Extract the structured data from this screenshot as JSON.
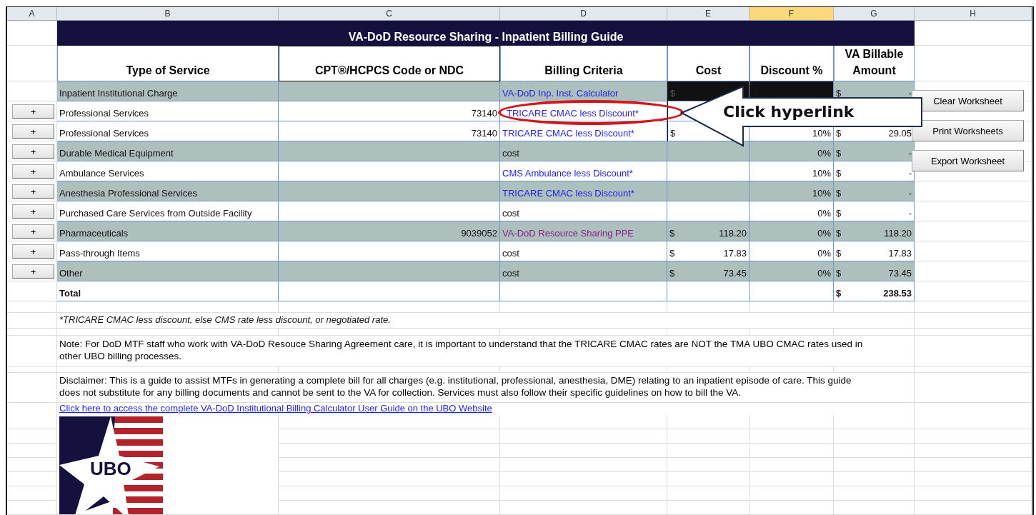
{
  "column_headers": [
    {
      "label": "A",
      "selected": false
    },
    {
      "label": "B",
      "selected": false
    },
    {
      "label": "C",
      "selected": false
    },
    {
      "label": "D",
      "selected": false
    },
    {
      "label": "E",
      "selected": false
    },
    {
      "label": "F",
      "selected": true
    },
    {
      "label": "G",
      "selected": false
    },
    {
      "label": "H",
      "selected": false
    }
  ],
  "title": "VA-DoD Resource Sharing - Inpatient Billing Guide",
  "table_headers": [
    "Type of Service",
    "CPT®/HCPCS Code or NDC",
    "Billing Criteria",
    "Cost",
    "Discount %",
    "VA Billable Amount"
  ],
  "rows": [
    {
      "service": "Inpatient Institutional Charge",
      "criteria": "VA-DoD Inp. Inst. Calculator",
      "hyperlink": true,
      "visited": false,
      "circled": false,
      "cost_sign": "$",
      "masked": true,
      "billable_sign": "$",
      "billable": "-",
      "shaded": true
    },
    {
      "button": "+",
      "service": "Professional Services",
      "code": "73140",
      "criteria": "TRICARE CMAC less Discount*",
      "hyperlink": true,
      "visited": false,
      "circled": true,
      "shaded": false,
      "masked": false
    },
    {
      "button": "+",
      "service": "Professional Services",
      "code": "73140",
      "criteria": "TRICARE CMAC less Discount*",
      "hyperlink": true,
      "visited": false,
      "circled": false,
      "cost_sign": "$",
      "discount": "10%",
      "billable_sign": "$",
      "billable": "29.05",
      "shaded": false,
      "masked": false
    },
    {
      "button": "+",
      "service": "Durable Medical Equipment",
      "criteria": "cost",
      "hyperlink": false,
      "visited": false,
      "circled": false,
      "discount": "0%",
      "billable_sign": "$",
      "billable": "-",
      "shaded": true,
      "masked": false
    },
    {
      "button": "+",
      "service": "Ambulance Services",
      "criteria": "CMS Ambulance less Discount*",
      "hyperlink": true,
      "visited": false,
      "circled": false,
      "discount": "10%",
      "billable_sign": "$",
      "billable": "-",
      "shaded": false,
      "masked": false
    },
    {
      "button": "+",
      "service": "Anesthesia Professional Services",
      "criteria": "TRICARE CMAC less Discount*",
      "hyperlink": true,
      "visited": false,
      "circled": false,
      "discount": "10%",
      "billable_sign": "$",
      "billable": "-",
      "shaded": true,
      "masked": false
    },
    {
      "button": "+",
      "service": "Purchased Care Services from Outside Facility",
      "criteria": "cost",
      "hyperlink": false,
      "visited": false,
      "circled": false,
      "discount": "0%",
      "billable_sign": "$",
      "billable": "-",
      "shaded": false,
      "masked": false
    },
    {
      "button": "+",
      "service": "Pharmaceuticals",
      "code": "9039052",
      "criteria": "VA-DoD Resource Sharing PPE",
      "hyperlink": true,
      "visited": true,
      "circled": false,
      "cost_sign": "$",
      "cost": "118.20",
      "discount": "0%",
      "billable_sign": "$",
      "billable": "118.20",
      "shaded": true,
      "masked": false
    },
    {
      "button": "+",
      "service": "Pass-through Items",
      "criteria": "cost",
      "hyperlink": false,
      "visited": false,
      "circled": false,
      "cost_sign": "$",
      "cost": "17.83",
      "discount": "0%",
      "billable_sign": "$",
      "billable": "17.83",
      "shaded": false,
      "masked": false
    },
    {
      "button": "+",
      "service": "Other",
      "criteria": "cost",
      "hyperlink": false,
      "visited": false,
      "circled": false,
      "cost_sign": "$",
      "cost": "73.45",
      "discount": "0%",
      "billable_sign": "$",
      "billable": "73.45",
      "shaded": true,
      "masked": false
    }
  ],
  "total": {
    "label": "Total",
    "sign": "$",
    "amount": "238.53"
  },
  "side_buttons": [
    "Clear Worksheet",
    "Print Worksheets",
    "Export Worksheet"
  ],
  "footnote": "*TRICARE CMAC less discount, else CMS rate less discount, or negotiated rate.",
  "note": "Note: For DoD MTF staff who work with VA-DoD Resouce Sharing Agreement care, it is important to understand that the TRICARE CMAC rates are NOT the TMA UBO CMAC rates used in other UBO billing processes.",
  "disclaimer": "Disclaimer: This is a guide to assist MTFs in generating a complete bill for all charges (e.g. institutional, professional, anesthesia, DME) relating to an inpatient episode of care. This guide does not substitute for any billing documents and cannot be sent to the VA for collection. Services must also follow their specific guidelines on how to bill the VA.",
  "guide_link": "Click here to access the complete VA-DoD Institutional Billing Calculator User Guide on the UBO Website",
  "logo_text": "UBO",
  "callout": "Click hyperlink"
}
